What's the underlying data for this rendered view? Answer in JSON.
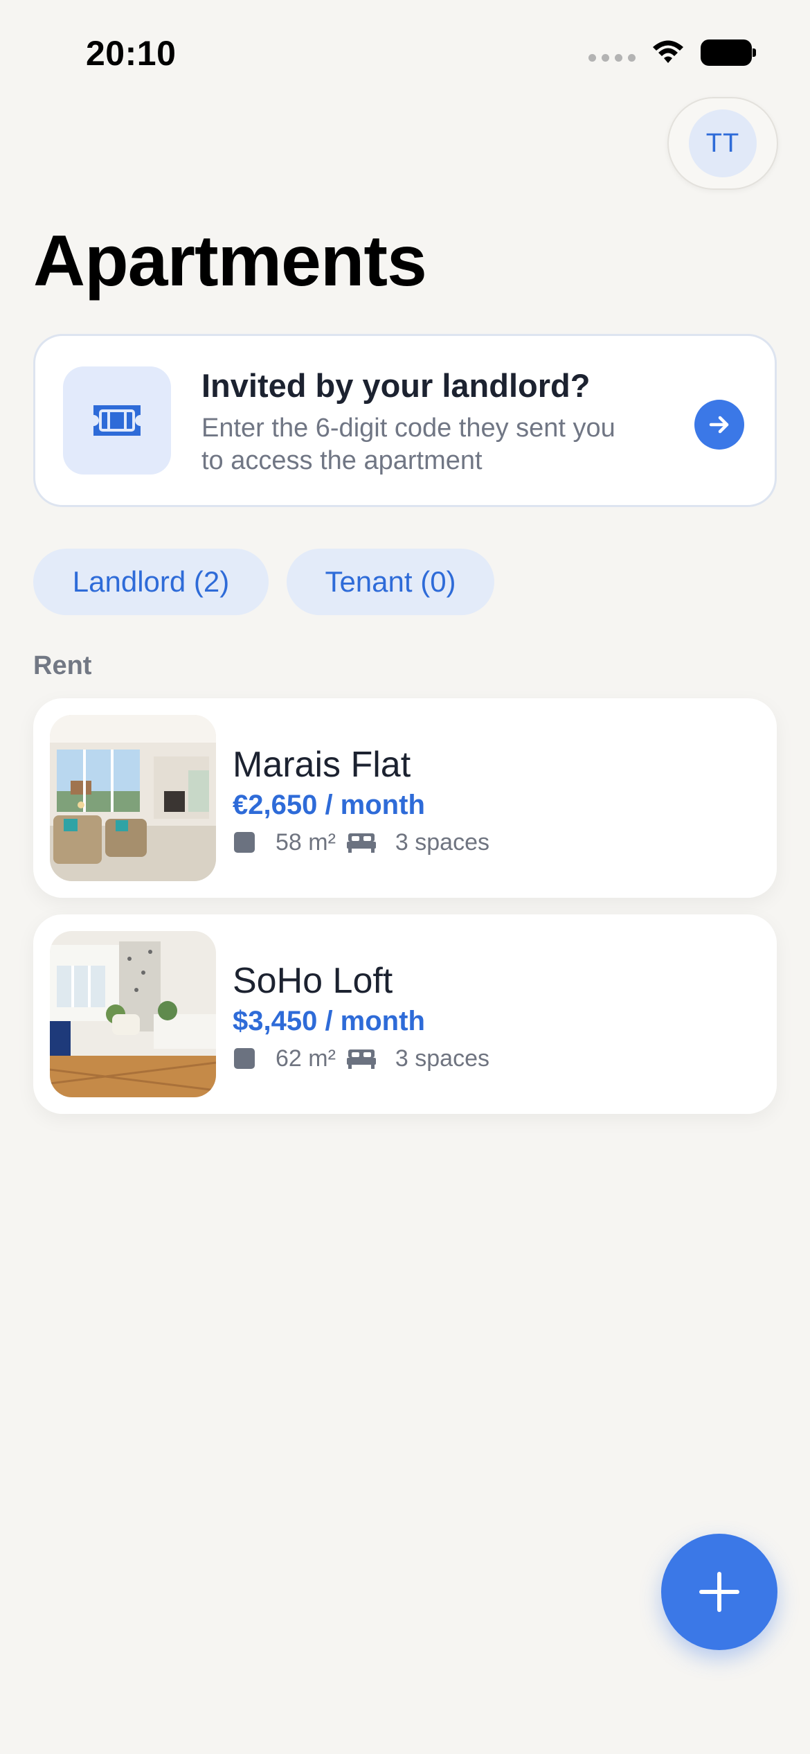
{
  "status_bar": {
    "time": "20:10"
  },
  "profile": {
    "initials": "TT"
  },
  "header": {
    "title": "Apartments"
  },
  "invite_card": {
    "title": "Invited by your landlord?",
    "subtitle": "Enter the 6-digit code they sent you to access the apartment",
    "icon": "ticket-icon",
    "action_icon": "arrow-right-icon"
  },
  "filters": [
    {
      "label": "Landlord (2)",
      "selected": true
    },
    {
      "label": "Tenant (0)",
      "selected": false
    }
  ],
  "section": {
    "label": "Rent"
  },
  "apartments": [
    {
      "name": "Marais Flat",
      "price": "€2,650 / month",
      "area": "58 m²",
      "spaces": "3 spaces"
    },
    {
      "name": "SoHo Loft",
      "price": "$3,450 / month",
      "area": "62 m²",
      "spaces": "3 spaces"
    }
  ],
  "fab": {
    "icon": "plus-icon"
  },
  "colors": {
    "accent": "#3b78e7",
    "accent_text": "#2e6bd8",
    "chip_bg": "#e3ebf9",
    "background": "#f6f5f2"
  }
}
